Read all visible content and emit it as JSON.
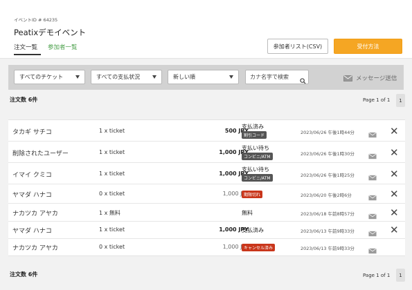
{
  "header": {
    "event_id": "イベントID # 64235",
    "title": "Peatixデモイベント",
    "tabs": [
      {
        "label": "注文一覧",
        "active": true
      },
      {
        "label": "参加者一覧",
        "active": false
      }
    ],
    "csv_button": "参加者リスト(CSV)",
    "checkin_button": "受付方法",
    "accent": "#f5a623",
    "link_color": "#4ea24e"
  },
  "filters": {
    "ticket": "すべてのチケット",
    "payment": "すべての支払状況",
    "sort": "新しい順",
    "search_placeholder": "カナ名字で検索",
    "message_label": "メッセージ送信"
  },
  "summary": {
    "count_label": "注文数 6件",
    "page_label": "Page 1 of 1",
    "page_number": "1"
  },
  "orders": [
    {
      "name": "タカギ サチコ",
      "qty": "1 x ticket",
      "price": "500 JPY",
      "status": "支払済み",
      "badge": "割引コード",
      "date": "2023/06/26 午後1時44分",
      "cancel": true
    },
    {
      "name": "削除されたユーザー",
      "qty": "1 x ticket",
      "price": "1,000 JPY",
      "status": "支払い待ち",
      "badge": "コンビニ/ATM",
      "date": "2023/06/26 午後1時30分",
      "cancel": true
    },
    {
      "name": "イマイ クミコ",
      "qty": "1 x ticket",
      "price": "1,000 JPY",
      "status": "支払い待ち",
      "badge": "コンビニ/ATM",
      "date": "2023/06/26 午後1時25分",
      "cancel": true
    },
    {
      "name": "ヤマダ ハナコ",
      "qty": "0 x ticket",
      "price": "1,000 JPY",
      "status": "",
      "badge": "期限切れ",
      "date": "2023/06/20 午後2時6分",
      "cancel": true
    },
    {
      "name": "ナカツカ アヤカ",
      "qty": "1 x 無料",
      "price": "",
      "status": "無料",
      "badge": "",
      "date": "2023/06/18 午前8時57分",
      "cancel": true
    },
    {
      "name": "ヤマダ ハナコ",
      "qty": "1 x ticket",
      "price": "1,000 JPY",
      "status": "支払済み",
      "badge": "",
      "date": "2023/06/13 午前9時33分",
      "cancel": true
    },
    {
      "name": "ナカツカ アヤカ",
      "qty": "0 x ticket",
      "price": "1,000 JPY",
      "status": "",
      "badge": "キャンセル済み",
      "date": "2023/06/13 午前9時33分",
      "cancel": false
    }
  ]
}
